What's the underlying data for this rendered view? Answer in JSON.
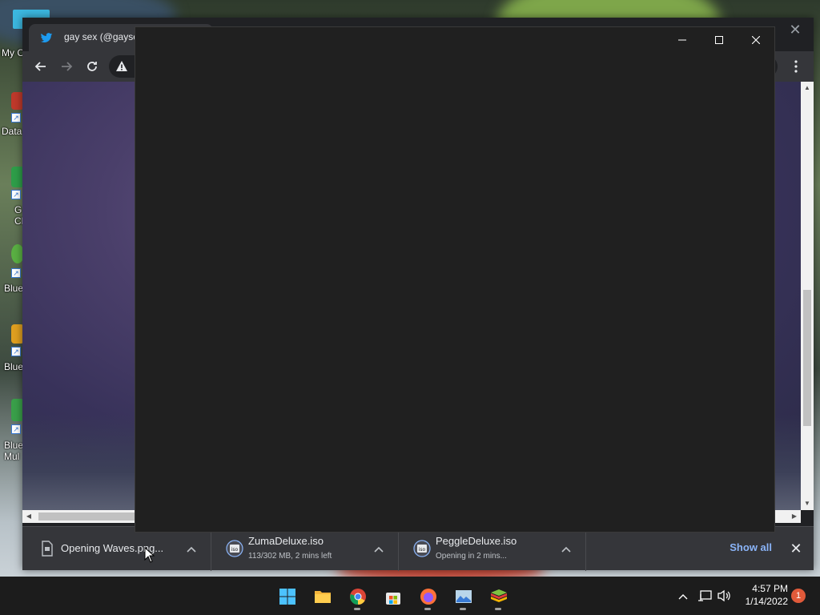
{
  "desktop": {
    "icons": [
      {
        "label": "My C"
      },
      {
        "label": "Data"
      },
      {
        "label": "G\nCh"
      },
      {
        "label": "Blue"
      },
      {
        "label": "Blue"
      },
      {
        "label": "Blue\nMul"
      }
    ]
  },
  "browser": {
    "tab_title": "gay sex (@gaysexd",
    "tab_icon": "twitter-icon",
    "close_glyph": "✕",
    "nav": {
      "back": "←",
      "forward": "→",
      "reload": "↻",
      "menu": "⋮"
    }
  },
  "downloads": {
    "items": [
      {
        "name": "Opening Waves.png...",
        "status": "",
        "icon": "file-icon"
      },
      {
        "name": "ZumaDeluxe.iso",
        "status": "113/302 MB, 2 mins left",
        "icon": "iso-icon"
      },
      {
        "name": "PeggleDeluxe.iso",
        "status": "Opening in 2 mins...",
        "icon": "iso-icon"
      }
    ],
    "show_all": "Show all",
    "close": "✕",
    "chevron": "^"
  },
  "blank_window": {
    "minimize": "—",
    "maximize": "☐",
    "close": "✕"
  },
  "taskbar": {
    "apps": [
      "start-icon",
      "file-explorer-icon",
      "chrome-icon",
      "store-icon",
      "firefox-icon",
      "photos-icon",
      "bluestacks-icon"
    ],
    "time": "4:57 PM",
    "date": "1/14/2022",
    "notifications": "1"
  },
  "colors": {
    "accent_blue": "#8ab4f8",
    "twitter_blue": "#1d9bf0",
    "window_bg": "#202020"
  }
}
